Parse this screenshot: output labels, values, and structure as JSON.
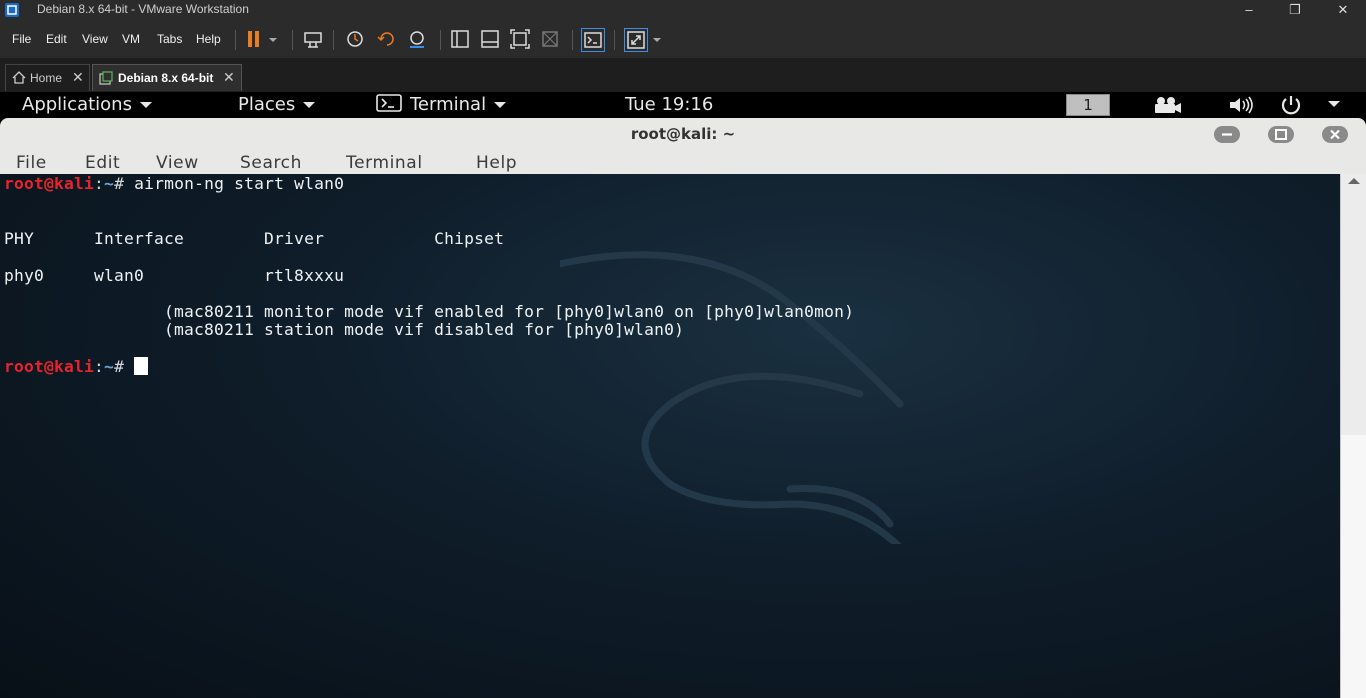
{
  "vm": {
    "window_title": "Debian 8.x 64-bit - VMware Workstation",
    "window_buttons": {
      "minimize": "–",
      "maximize": "❐",
      "close": "✕"
    },
    "menu": [
      "File",
      "Edit",
      "View",
      "VM",
      "Tabs",
      "Help"
    ],
    "tabs": [
      {
        "label": "Home",
        "icon": "home-icon"
      },
      {
        "label": "Debian 8.x 64-bit",
        "icon": "vm-icon"
      }
    ],
    "tab_close": "✕",
    "accent_color": "#e87d22"
  },
  "gnome": {
    "applications": "Applications",
    "places": "Places",
    "terminal_menu": "Terminal",
    "clock": "Tue 19:16",
    "workspace": "1"
  },
  "terminal": {
    "title": "root@kali: ~",
    "menu": [
      "File",
      "Edit",
      "View",
      "Search",
      "Terminal",
      "Help"
    ],
    "prompt": {
      "user_host": "root@kali",
      "separator": ":",
      "cwd": "~",
      "symbol": "# "
    },
    "command": "airmon-ng start wlan0",
    "output": [
      "",
      "PHY      Interface        Driver           Chipset",
      "",
      "phy0     wlan0            rtl8xxxu",
      "",
      "                (mac80211 monitor mode vif enabled for [phy0]wlan0 on [phy0]wlan0mon)",
      "                (mac80211 station mode vif disabled for [phy0]wlan0)",
      ""
    ]
  }
}
